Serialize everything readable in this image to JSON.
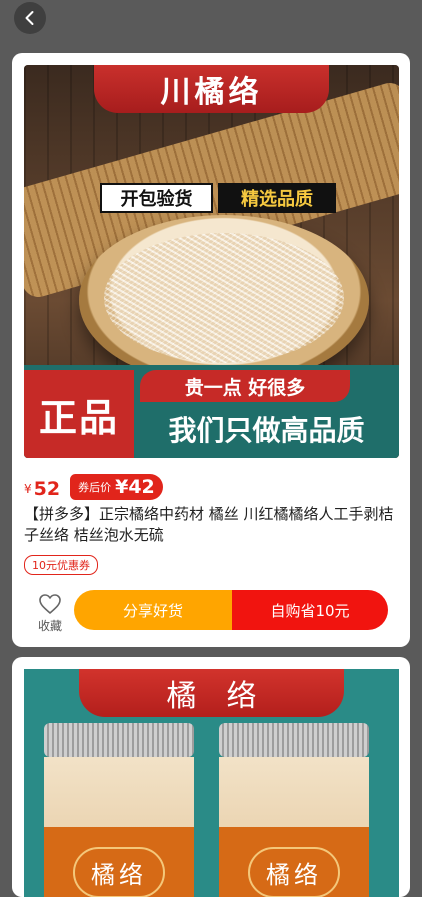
{
  "nav": {
    "back_icon": "chevron-left-icon"
  },
  "products": [
    {
      "image_title": "川橘络",
      "image_tag1": "开包验货",
      "image_tag2": "精选品质",
      "image_badge": "正品",
      "image_slogan1": "贵一点 好很多",
      "image_slogan2": "我们只做高品质",
      "currency": "¥",
      "price": "52",
      "coupon_price_label": "券后价",
      "coupon_price": "¥42",
      "title": "【拼多多】正宗橘络中药材 橘丝 川红橘橘络人工手剥桔子丝络 桔丝泡水无硫",
      "coupon_badge": "10元优惠券",
      "fav_label": "收藏",
      "share_label": "分享好货",
      "buy_label": "自购省10元"
    },
    {
      "image_title": "橘络",
      "jar_label_left": "橘络",
      "jar_label_right": "橘络"
    }
  ],
  "colors": {
    "accent": "#e1251b",
    "share": "#ffa500",
    "buy": "#f1140f"
  }
}
